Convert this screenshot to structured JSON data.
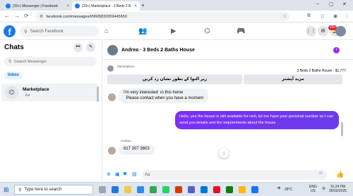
{
  "browser": {
    "tabs": [
      {
        "title": "(20+) Messenger | Facebook",
        "active": false
      },
      {
        "title": "(20+) Marketplace - 3 Beds 2 B...",
        "active": true
      }
    ],
    "new_tab": "+",
    "url": "facebook.com/messages/t/9605832659445650",
    "window_controls": {
      "minimize": "–",
      "maximize": "▢",
      "close": "✕"
    },
    "icons": [
      "back-icon",
      "forward-icon",
      "reload-icon",
      "extensions-icon",
      "bookmark-icon",
      "profile-icon",
      "menu-icon"
    ]
  },
  "fb_header": {
    "logo": "f",
    "search_placeholder": "Search Facebook",
    "notification_count": "20+",
    "nav_icons": [
      "home-icon",
      "friends-icon",
      "video-icon",
      "marketplace-icon",
      "gaming-icon"
    ],
    "right_icons": [
      "grid-menu-icon",
      "messenger-icon",
      "bell-icon"
    ]
  },
  "sidebar": {
    "title": "Chats",
    "more": "•••",
    "compose": "✎",
    "search_placeholder": "Search Messenger",
    "filter": "Inbox",
    "conversation": {
      "name": "Marketplace",
      "time": "· 2w"
    }
  },
  "chat": {
    "title": "Andrea · 3 Beds 2 Baths House",
    "info": "i",
    "marketplace_label": "Marketplace",
    "listing_title": "3 Beds 2 Baths House - $1,777",
    "action_buttons": [
      "زیر التوا کے بطور نشان زد کریں",
      "مزید آپشنز"
    ],
    "messages": [
      {
        "from": "in",
        "text": "I'm very interested  in this home\n  Please contact when you have a moment"
      },
      {
        "from": "out",
        "text": "Hello, yes the house is still available for rent, let me have your personal number so I can send you details and the requirements about the house"
      },
      {
        "from": "in",
        "sender": "Andrea",
        "text": "817 307 3603"
      }
    ],
    "scroll_down": "↓",
    "composer_placeholder": "Aa",
    "composer_icons": [
      "plus-icon",
      "camera-icon",
      "sticker-icon",
      "gif-icon"
    ]
  },
  "taskbar": {
    "search_placeholder": "Type here to search",
    "weather": "28°C",
    "language": "ENG",
    "region": "US",
    "time": "11:24 PM",
    "date": "26/02/2025"
  }
}
